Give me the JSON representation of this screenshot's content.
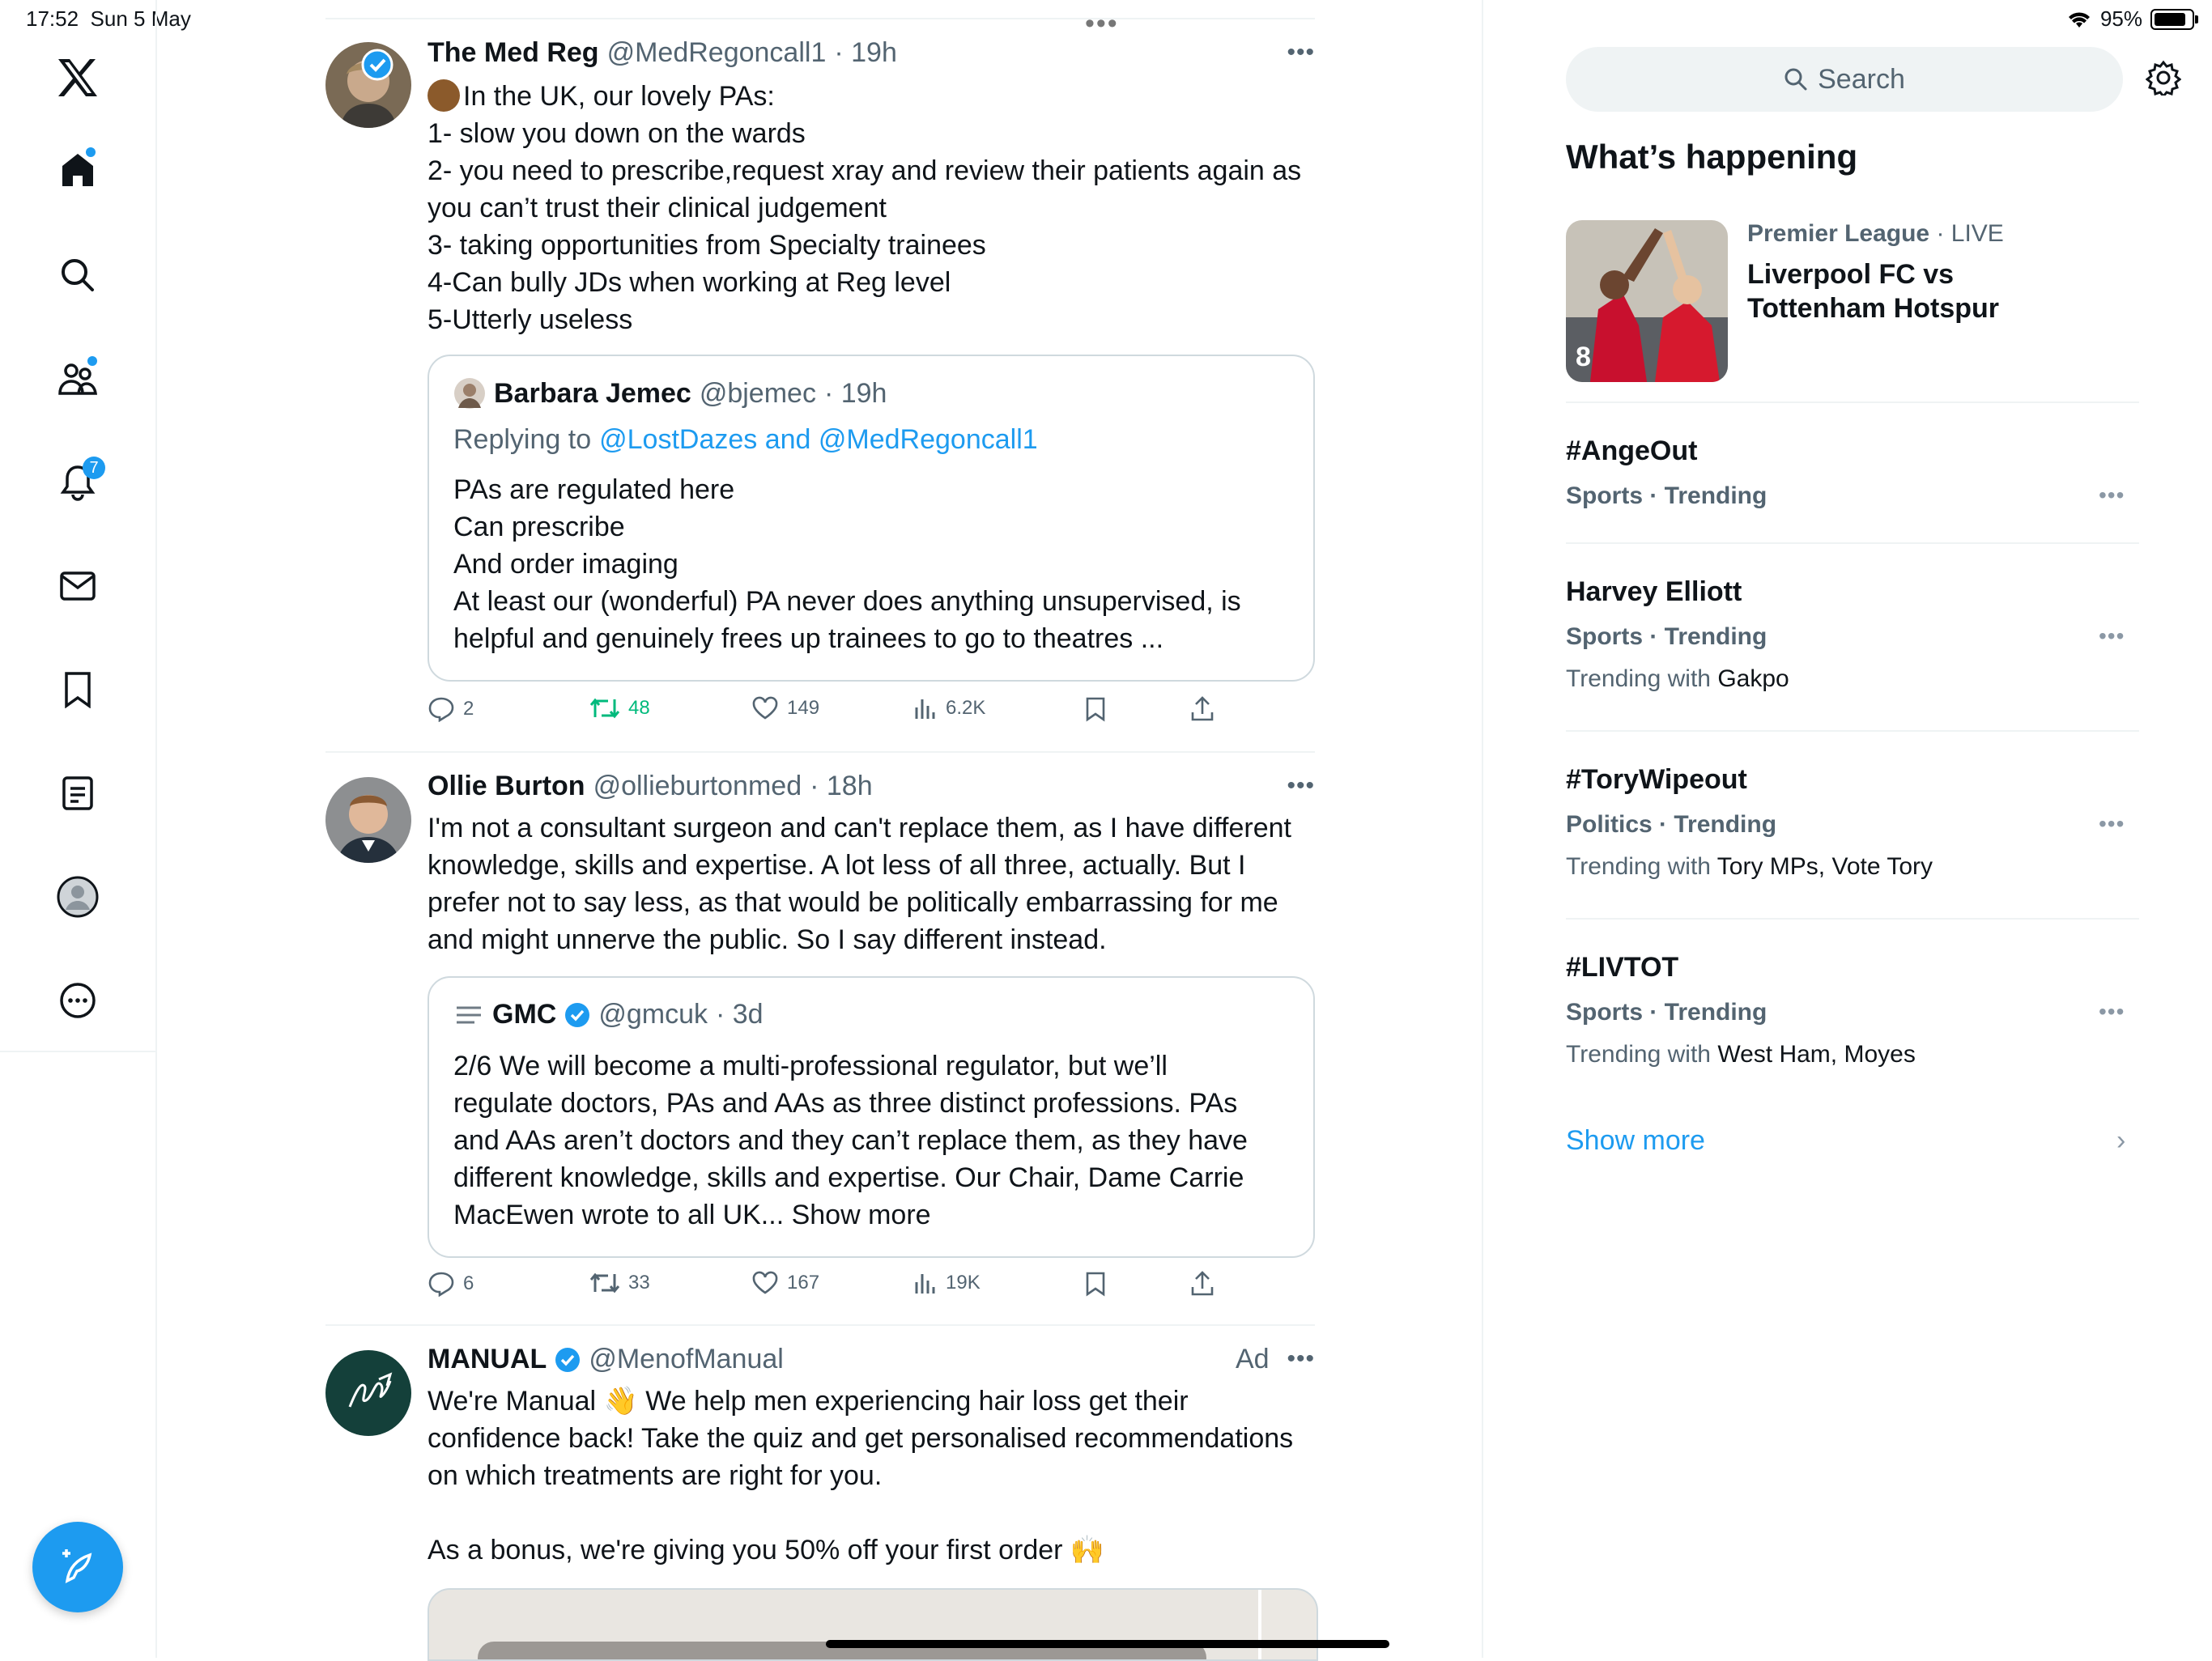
{
  "status": {
    "time": "17:52",
    "date": "Sun 5 May",
    "battery": "95%",
    "battery_level": 0.95
  },
  "nav": {
    "notifications_badge": "7",
    "items": [
      "home-icon",
      "search-icon",
      "communities-icon",
      "notifications-icon",
      "messages-icon",
      "bookmarks-icon",
      "lists-icon",
      "profile-icon",
      "more-icon"
    ]
  },
  "tweets": [
    {
      "name": "The Med Reg",
      "handle": "@MedRegoncall1",
      "time": "· 19h",
      "lines": [
        "In the UK, our lovely PAs:",
        "1- slow you down on the wards",
        "2- you need to prescribe,request xray and review their patients again as",
        "you can’t trust their clinical judgement",
        "3- taking opportunities from Specialty trainees",
        "4-Can bully JDs when working at Reg level",
        "5-Utterly useless"
      ],
      "quote": {
        "name": "Barbara Jemec",
        "handle": "@bjemec",
        "time": "· 19h",
        "replying_prefix": "Replying to",
        "replying_targets": "@LostDazes and @MedRegoncall1",
        "lines": [
          "PAs are regulated here",
          "Can prescribe",
          "And order imaging",
          "At least our (wonderful) PA never does anything unsupervised, is",
          "helpful and genuinely frees up trainees to go to theatres ..."
        ]
      },
      "stats": {
        "replies": "2",
        "retweets": "48",
        "likes": "149",
        "views": "6.2K"
      }
    },
    {
      "name": "Ollie Burton",
      "handle": "@ollieburtonmed",
      "time": "· 18h",
      "lines": [
        "I'm not a consultant surgeon and can't replace them, as I have different",
        "knowledge, skills and expertise. A lot less of all three, actually. But I",
        "prefer not to say less, as that would be politically embarrassing for me",
        "and might unnerve the public. So I say different instead."
      ],
      "quote": {
        "name": "GMC",
        "handle": "@gmcuk",
        "time": "· 3d",
        "lines": [
          "2/6 We will become a multi-professional regulator, but we’ll",
          "regulate doctors, PAs and AAs as three distinct professions. PAs",
          "and AAs aren’t doctors and they can’t replace them, as they have",
          "different knowledge, skills and expertise. Our Chair, Dame Carrie",
          "MacEwen wrote to all UK... Show more"
        ]
      },
      "stats": {
        "replies": "6",
        "retweets": "33",
        "likes": "167",
        "views": "19K"
      }
    },
    {
      "name": "MANUAL",
      "handle": "@MenofManual",
      "ad_label": "Ad",
      "lines": [
        "We're Manual 👋 We help men experiencing hair loss get their",
        "confidence back! Take the quiz and get personalised recommendations",
        "on which treatments are right for you.",
        "",
        "As a bonus, we're giving you 50% off your first order 🙌"
      ]
    }
  ],
  "right": {
    "search_placeholder": "Search",
    "section_title": "What’s happening",
    "featured": {
      "category": "Premier League",
      "status": "· LIVE",
      "line1": "Liverpool FC vs",
      "line2": "Tottenham Hotspur"
    },
    "trends": [
      {
        "title": "#AngeOut",
        "meta": "Sports · Trending",
        "with_prefix": "",
        "with_names": ""
      },
      {
        "title": "Harvey Elliott",
        "meta": "Sports · Trending",
        "with_prefix": "Trending with",
        "with_names": "Gakpo"
      },
      {
        "title": "#ToryWipeout",
        "meta": "Politics · Trending",
        "with_prefix": "Trending with",
        "with_names": "Tory MPs, Vote Tory"
      },
      {
        "title": "#LIVTOT",
        "meta": "Sports · Trending",
        "with_prefix": "Trending with",
        "with_names": "West Ham, Moyes"
      }
    ],
    "show_more": "Show more"
  },
  "colors": {
    "accent": "#1d9bf0",
    "retweet_green": "#00ba7c",
    "muted": "#536471"
  }
}
